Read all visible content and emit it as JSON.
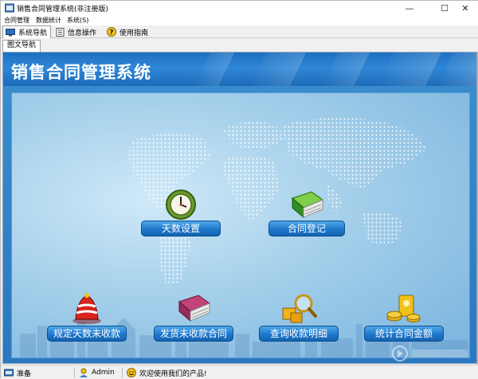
{
  "window": {
    "title": "销售合同管理系统(非注册版)",
    "controls": {
      "minimize": "—",
      "maximize": "☐",
      "close": "✕"
    }
  },
  "menubar": {
    "items": [
      "合同管理",
      "数据统计",
      "系统(S)"
    ]
  },
  "toolbar": {
    "tabs": [
      {
        "label": "系统导航",
        "icon": "monitor-icon",
        "active": true
      },
      {
        "label": "信息操作",
        "icon": "document-icon",
        "active": false
      },
      {
        "label": "使用指南",
        "icon": "help-icon",
        "active": false
      }
    ]
  },
  "subtab": {
    "label": "图文导航"
  },
  "main": {
    "app_title": "销售合同管理系统",
    "nav": [
      {
        "label": "天数设置",
        "icon": "clock-icon"
      },
      {
        "label": "合同登记",
        "icon": "green-book-icon"
      },
      {
        "label": "规定天数未收款",
        "icon": "alarm-bell-icon"
      },
      {
        "label": "发货未收款合同",
        "icon": "pink-book-icon"
      },
      {
        "label": "查询收款明细",
        "icon": "magnifier-icon"
      },
      {
        "label": "统计合同金额",
        "icon": "gold-coins-icon"
      }
    ]
  },
  "statusbar": {
    "ready": "准备",
    "user": "Admin",
    "welcome": "欢迎使用我们的产品!"
  },
  "colors": {
    "header_blue": "#1f6fc0",
    "button_blue": "#1f78cc",
    "stage_light": "#cfe9f8"
  }
}
